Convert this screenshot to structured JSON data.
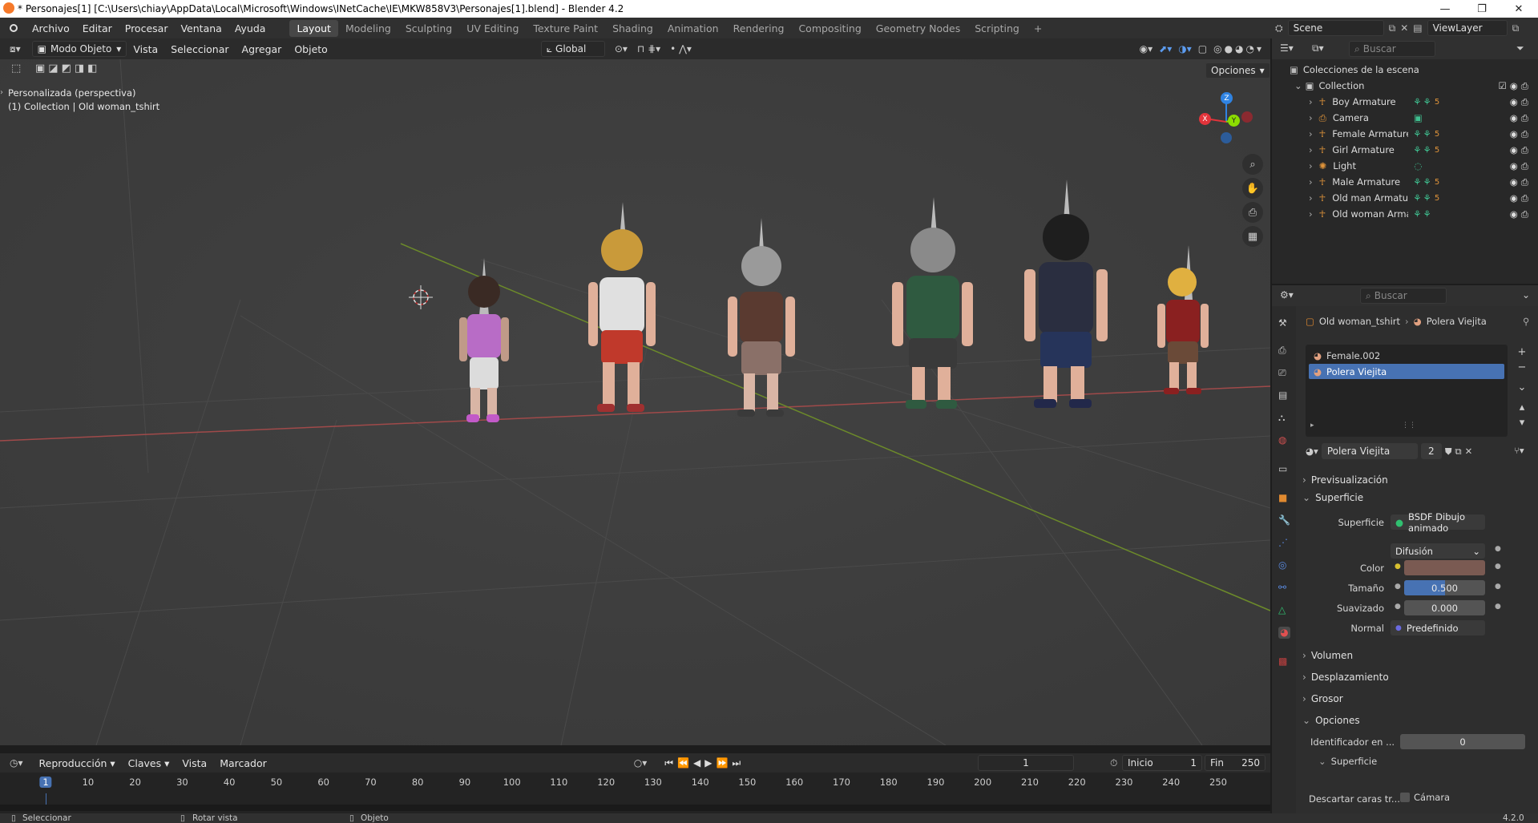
{
  "window": {
    "title": "* Personajes[1] [C:\\Users\\chiay\\AppData\\Local\\Microsoft\\Windows\\INetCache\\IE\\MKW858V3\\Personajes[1].blend] - Blender 4.2",
    "minimize": "—",
    "maximize": "❐",
    "close": "✕"
  },
  "menus": [
    "Archivo",
    "Editar",
    "Procesar",
    "Ventana",
    "Ayuda"
  ],
  "workspaces": [
    "Layout",
    "Modeling",
    "Sculpting",
    "UV Editing",
    "Texture Paint",
    "Shading",
    "Animation",
    "Rendering",
    "Compositing",
    "Geometry Nodes",
    "Scripting",
    "+"
  ],
  "scene": {
    "name": "Scene",
    "view_layer": "ViewLayer"
  },
  "viewport_header": {
    "mode": "Modo Objeto",
    "menus": [
      "Vista",
      "Seleccionar",
      "Agregar",
      "Objeto"
    ],
    "transform": "Global",
    "options": "Opciones"
  },
  "viewport": {
    "view_name": "Personalizada (perspectiva)",
    "collection_info": "(1) Collection | Old woman_tshirt",
    "axes": {
      "x": "X",
      "y": "Y",
      "z": "Z"
    }
  },
  "outliner": {
    "search_placeholder": "Buscar",
    "root": "Colecciones de la escena",
    "collection": "Collection",
    "items": [
      {
        "name": "Boy Armature",
        "badge": "5"
      },
      {
        "name": "Camera",
        "badge": ""
      },
      {
        "name": "Female Armature",
        "badge": "5"
      },
      {
        "name": "Girl Armature",
        "badge": "5"
      },
      {
        "name": "Light",
        "badge": ""
      },
      {
        "name": "Male Armature",
        "badge": "5"
      },
      {
        "name": "Old man Armature",
        "badge": "5"
      },
      {
        "name": "Old woman Armature",
        "badge": ""
      }
    ]
  },
  "properties": {
    "search_placeholder": "Buscar",
    "breadcrumb_object": "Old woman_tshirt",
    "breadcrumb_material": "Polera Viejita",
    "slots": [
      "Female.002",
      "Polera Viejita"
    ],
    "material_name": "Polera Viejita",
    "material_users": "2",
    "panels": {
      "preview": "Previsualización",
      "surface": "Superficie",
      "volume": "Volumen",
      "displacement": "Desplazamiento",
      "thickness": "Grosor",
      "options": "Opciones"
    },
    "surface": {
      "label": "Superficie",
      "shader": "BSDF Dibujo animado",
      "mode": "Difusión",
      "color_label": "Color",
      "color": "#7a5a52",
      "size_label": "Tamaño",
      "size_value": "0.500",
      "size_fraction": 0.5,
      "smooth_label": "Suavizado",
      "smooth_value": "0.000",
      "normal_label": "Normal",
      "normal_value": "Predefinido"
    },
    "options": {
      "pass_index_label": "Identificador en ...",
      "pass_index_value": "0",
      "sub_surface": "Superficie",
      "backface_label": "Descartar caras tr...",
      "backface_option": "Cámara"
    }
  },
  "timeline": {
    "menus": [
      "Reproducción",
      "Claves",
      "Vista",
      "Marcador"
    ],
    "current_frame": "1",
    "start_label": "Inicio",
    "start": "1",
    "end_label": "Fin",
    "end": "250",
    "ticks": [
      "1",
      "10",
      "20",
      "30",
      "40",
      "50",
      "60",
      "70",
      "80",
      "90",
      "100",
      "110",
      "120",
      "130",
      "140",
      "150",
      "160",
      "170",
      "180",
      "190",
      "200",
      "210",
      "220",
      "230",
      "240",
      "250"
    ]
  },
  "statusbar": {
    "select": "Seleccionar",
    "rotate": "Rotar vista",
    "object": "Objeto",
    "version": "4.2.0"
  },
  "colors": {
    "accent": "#4772b3",
    "axis_x": "#e2343b",
    "axis_y": "#8bdc00",
    "axis_z": "#2f83e2"
  }
}
